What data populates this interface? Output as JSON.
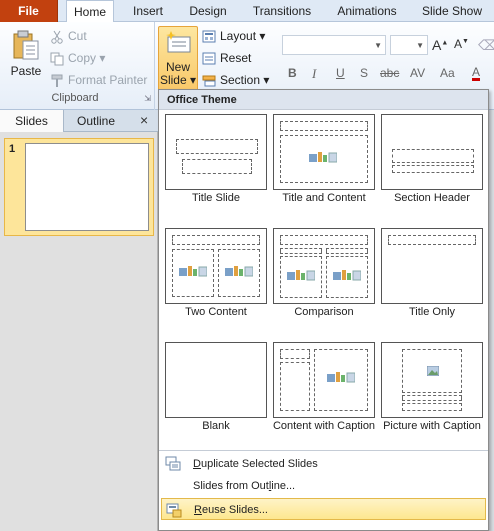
{
  "ribbon_tabs": {
    "file": "File",
    "home": "Home",
    "insert": "Insert",
    "design": "Design",
    "transitions": "Transitions",
    "animations": "Animations",
    "slide_show": "Slide Show"
  },
  "clipboard": {
    "paste": "Paste",
    "cut": "Cut",
    "copy": "Copy",
    "format_painter": "Format Painter",
    "group_label": "Clipboard"
  },
  "slides_group": {
    "new_slide_line1": "New",
    "new_slide_line2": "Slide",
    "layout": "Layout",
    "reset": "Reset",
    "section": "Section"
  },
  "font_group": {
    "font_name": "",
    "font_size": "",
    "grow": "A",
    "shrink": "A",
    "bold": "B",
    "italic": "I",
    "underline": "U",
    "shadow": "S",
    "strikethrough": "abc",
    "char_spacing": "AV",
    "change_case": "Aa",
    "font_color": "A"
  },
  "panel": {
    "tab_slides": "Slides",
    "tab_outline": "Outline",
    "close": "×",
    "slide_number": "1"
  },
  "gallery": {
    "header": "Office Theme",
    "layouts": [
      {
        "caption": "Title Slide"
      },
      {
        "caption": "Title and Content"
      },
      {
        "caption": "Section Header"
      },
      {
        "caption": "Two Content"
      },
      {
        "caption": "Comparison"
      },
      {
        "caption": "Title Only"
      },
      {
        "caption": "Blank"
      },
      {
        "caption": "Content with Caption"
      },
      {
        "caption": "Picture with Caption"
      }
    ],
    "menu": [
      {
        "pre": "",
        "acc": "D",
        "post": "uplicate Selected Slides"
      },
      {
        "pre": "Slides from Out",
        "acc": "l",
        "post": "ine..."
      },
      {
        "pre": "",
        "acc": "R",
        "post": "euse Slides..."
      }
    ]
  },
  "colors": {
    "file_tab": "#c2410f",
    "highlight": "#fde59a",
    "ribbon_bg": "#dfe9f5"
  }
}
